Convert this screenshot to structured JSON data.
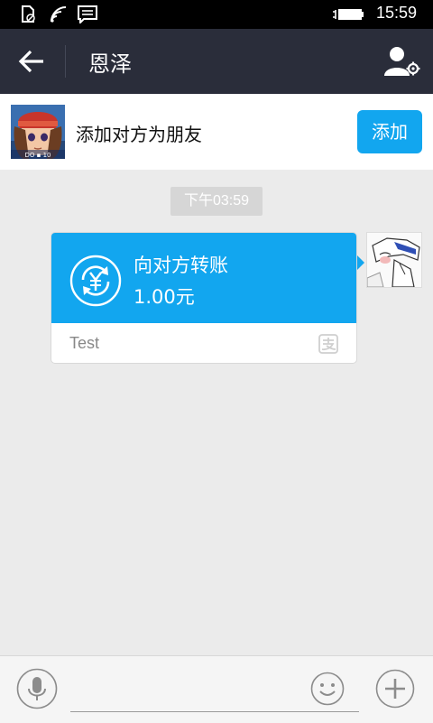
{
  "status_bar": {
    "time": "15:59",
    "icons": [
      "no-sim-icon",
      "wifi-icon",
      "message-notification-icon",
      "battery-charging-icon"
    ]
  },
  "header": {
    "title": "恩泽",
    "back_icon": "back-arrow-icon",
    "profile_icon": "contact-settings-icon"
  },
  "add_friend_banner": {
    "text": "添加对方为朋友",
    "button_label": "添加",
    "avatar_badge": "DO ▪ 10"
  },
  "chat": {
    "timestamp": "下午03:59",
    "transfer": {
      "title": "向对方转账",
      "amount": "1.00元",
      "note": "Test",
      "icon": "yen-transfer-icon",
      "service_icon": "alipay-icon"
    }
  },
  "input_bar": {
    "voice_icon": "microphone-icon",
    "emoji_icon": "emoji-icon",
    "more_icon": "plus-icon"
  },
  "colors": {
    "status_bar_bg": "#000000",
    "header_bg": "#2a2d3a",
    "accent": "#12a6ef",
    "chat_bg": "#ebebeb"
  }
}
